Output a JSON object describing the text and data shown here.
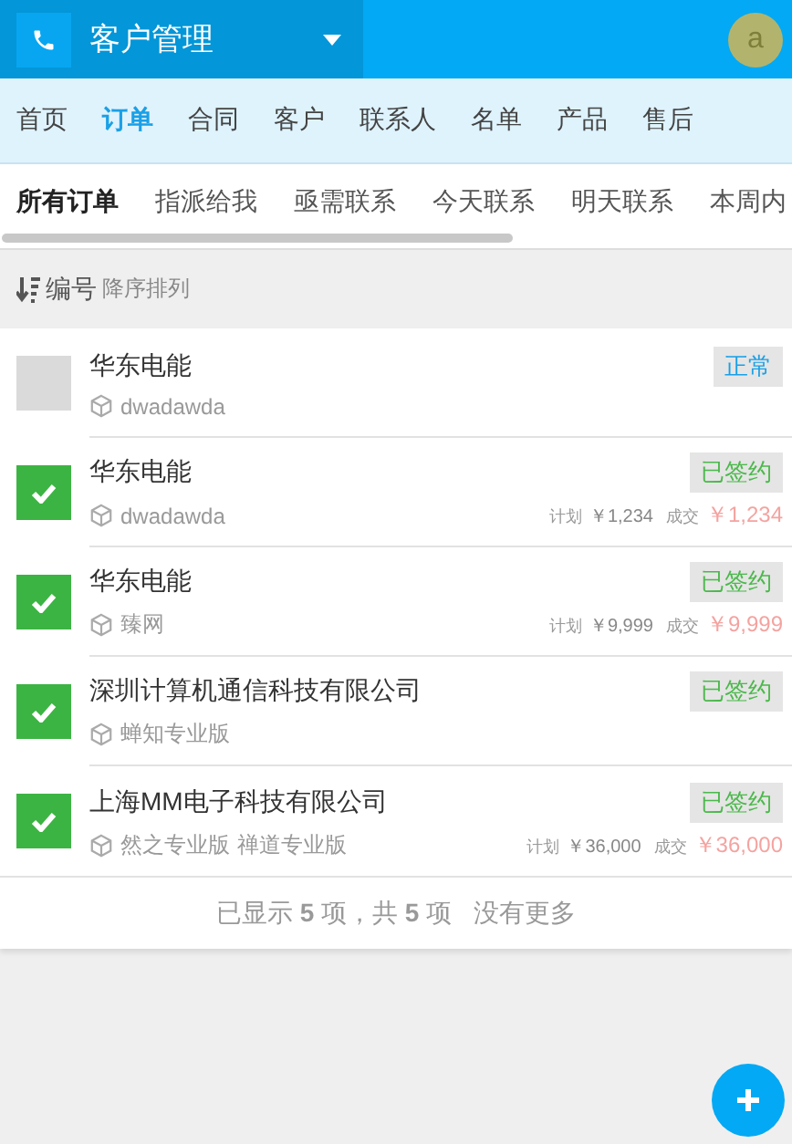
{
  "header": {
    "title": "客户管理",
    "avatar": "a"
  },
  "nav": [
    {
      "label": "首页",
      "selected": false
    },
    {
      "label": "订单",
      "selected": true
    },
    {
      "label": "合同",
      "selected": false
    },
    {
      "label": "客户",
      "selected": false
    },
    {
      "label": "联系人",
      "selected": false
    },
    {
      "label": "名单",
      "selected": false
    },
    {
      "label": "产品",
      "selected": false
    },
    {
      "label": "售后",
      "selected": false
    }
  ],
  "filters": [
    {
      "label": "所有订单",
      "selected": true
    },
    {
      "label": "指派给我",
      "selected": false
    },
    {
      "label": "亟需联系",
      "selected": false
    },
    {
      "label": "今天联系",
      "selected": false
    },
    {
      "label": "明天联系",
      "selected": false
    },
    {
      "label": "本周内",
      "selected": false
    }
  ],
  "sort": {
    "field": "编号",
    "order": "降序排列"
  },
  "orders": [
    {
      "customer": "华东电能",
      "checked": false,
      "products": [
        "dwadawda"
      ],
      "status": {
        "label": "正常",
        "color": "#1aa0e6"
      }
    },
    {
      "customer": "华东电能",
      "checked": true,
      "products": [
        "dwadawda"
      ],
      "status": {
        "label": "已签约",
        "color": "#4cb84c"
      },
      "plan_label": "计划",
      "plan": "￥1,234",
      "deal_label": "成交",
      "deal": "￥1,234"
    },
    {
      "customer": "华东电能",
      "checked": true,
      "products": [
        "臻网"
      ],
      "status": {
        "label": "已签约",
        "color": "#4cb84c"
      },
      "plan_label": "计划",
      "plan": "￥9,999",
      "deal_label": "成交",
      "deal": "￥9,999"
    },
    {
      "customer": "深圳计算机通信科技有限公司",
      "checked": true,
      "products": [
        "蝉知专业版"
      ],
      "status": {
        "label": "已签约",
        "color": "#4cb84c"
      }
    },
    {
      "customer": "上海MM电子科技有限公司",
      "checked": true,
      "products": [
        "然之专业版",
        "禅道专业版"
      ],
      "status": {
        "label": "已签约",
        "color": "#4cb84c"
      },
      "plan_label": "计划",
      "plan": "￥36,000",
      "deal_label": "成交",
      "deal": "￥36,000"
    }
  ],
  "footer": {
    "summary": "已显示 **5** 项，共 **5** 项",
    "more": "没有更多"
  }
}
